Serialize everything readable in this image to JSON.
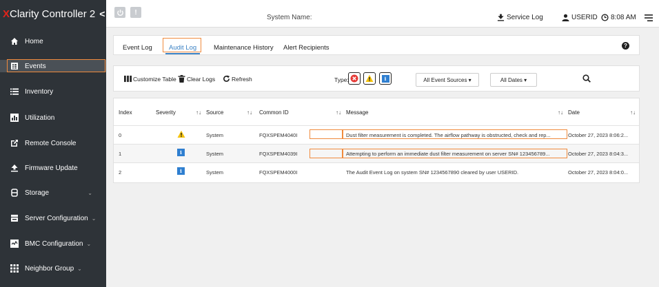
{
  "brand": {
    "prefix": "X",
    "name": "Clarity Controller 2",
    "collapse_glyph": "<"
  },
  "colors": {
    "sidebar_bg": "#2e3338",
    "accent": "#3b82c4",
    "highlight": "#f08a3c",
    "brand_red": "#e2231a",
    "info_blue": "#2f7fd0",
    "warning_yellow": "#f4c20d",
    "error_red": "#e53935"
  },
  "sidebar": {
    "items": [
      {
        "label": "Home",
        "icon": "home-icon"
      },
      {
        "label": "Events",
        "icon": "events-icon"
      },
      {
        "label": "Inventory",
        "icon": "list-icon"
      },
      {
        "label": "Utilization",
        "icon": "bar-chart-icon"
      },
      {
        "label": "Remote Console",
        "icon": "external-link-icon"
      },
      {
        "label": "Firmware Update",
        "icon": "upload-icon"
      },
      {
        "label": "Storage",
        "icon": "storage-icon"
      },
      {
        "label": "Server Configuration",
        "icon": "server-icon"
      },
      {
        "label": "BMC Configuration",
        "icon": "bmc-icon"
      },
      {
        "label": "Neighbor Group",
        "icon": "grid-icon"
      }
    ]
  },
  "topbar": {
    "power_icon": "power-icon",
    "alert_glyph": "!",
    "system_name_label": "System Name:",
    "service_log": "Service Log",
    "user": "USERID",
    "time": "8:08 AM"
  },
  "tabs": [
    {
      "label": "Event Log"
    },
    {
      "label": "Audit Log",
      "active": true
    },
    {
      "label": "Maintenance History"
    },
    {
      "label": "Alert Recipients"
    }
  ],
  "help_glyph": "?",
  "toolbar": {
    "customize": "Customize Table",
    "clear": "Clear Logs",
    "refresh": "Refresh",
    "type_label": "Type:",
    "event_sources": "All Event Sources ▾",
    "dates": "All Dates ▾"
  },
  "table": {
    "headers": [
      "Index",
      "Severity",
      "Source",
      "Common ID",
      "Message",
      "Date"
    ],
    "sort_glyph": "↑↓",
    "rows": [
      {
        "index": "0",
        "severity": "warning",
        "source": "System",
        "common_id": "FQXSPEM4040I",
        "message": "Dust filter measurement is completed. The airflow pathway is obstructed, check and rep...",
        "date": "October 27, 2023 8:06:2..."
      },
      {
        "index": "1",
        "severity": "info",
        "source": "System",
        "common_id": "FQXSPEM4039I",
        "message": "Attempting to perform an immediate dust filter measurement on server SN# 123456789...",
        "date": "October 27, 2023 8:04:3..."
      },
      {
        "index": "2",
        "severity": "info",
        "source": "System",
        "common_id": "FQXSPEM4000I",
        "message": "The Audit Event Log on system SN# 1234567890 cleared by user USERID.",
        "date": "October 27, 2023 8:04:0..."
      }
    ],
    "info_glyph": "i"
  }
}
